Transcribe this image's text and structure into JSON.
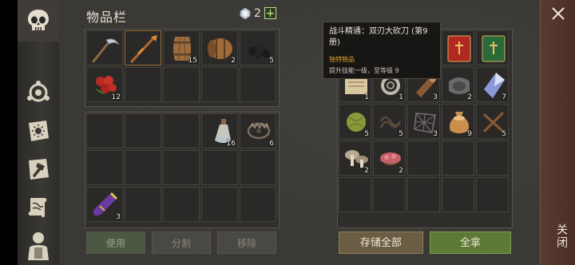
{
  "inventory": {
    "title": "物品栏",
    "gem_count": "2",
    "add_label": "+"
  },
  "left_quantities": {
    "barrel2": "15",
    "keg": "2",
    "coal": "5",
    "berries": "12",
    "potion": "16",
    "trap": "6",
    "vial": "3"
  },
  "left_buttons": {
    "use": "使用",
    "split": "分割",
    "remove": "移除"
  },
  "tooltip": {
    "title": "战斗精通：双刃大砍刀 (第9册)",
    "rarity": "独特物品",
    "description": "提升技能一级，至等级 9"
  },
  "right_quantities": {
    "r1c0": "1",
    "r1c1": "1",
    "r1c2": "3",
    "r1c3": "2",
    "r1c4": "7",
    "r2c0": "5",
    "r2c1": "5",
    "r2c2": "3",
    "r2c3": "9",
    "r2c4": "5",
    "r3c0": "2",
    "r3c1": "2"
  },
  "right_buttons": {
    "store_all": "存储全部",
    "take_all": "全拿"
  },
  "close": {
    "label": "关闭"
  }
}
